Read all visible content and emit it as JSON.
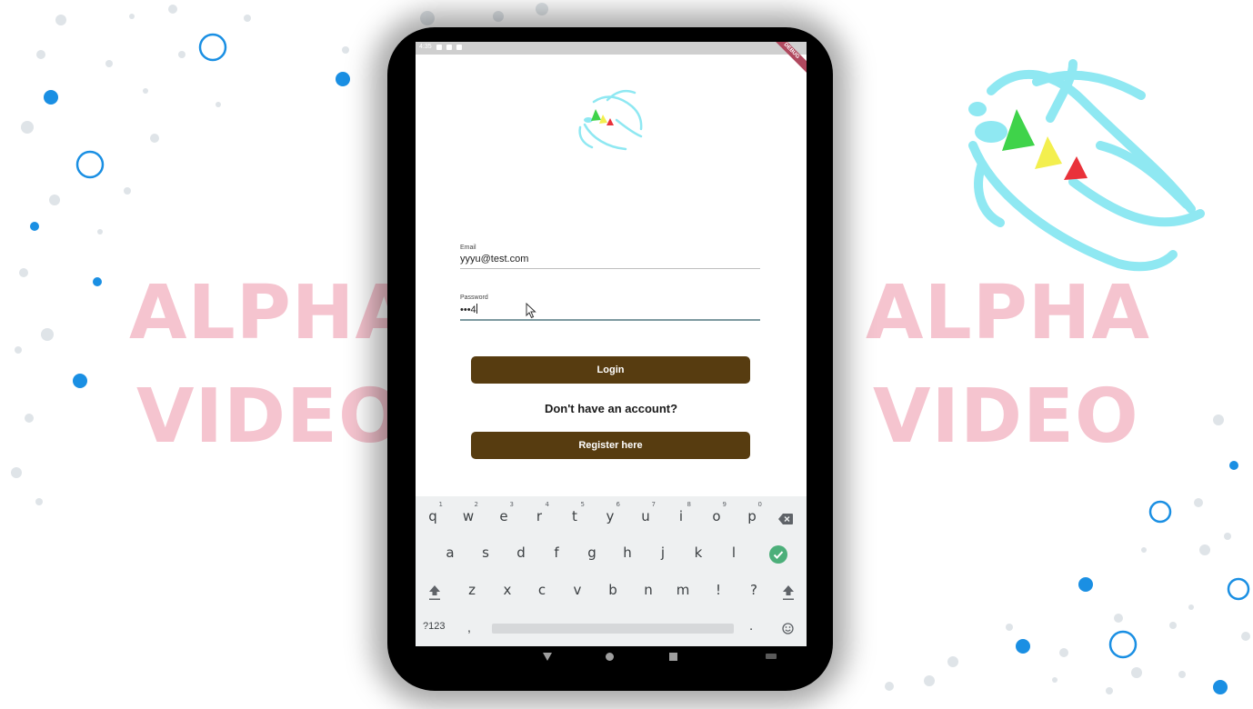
{
  "watermark": {
    "left": [
      "ALPHA",
      "VIDEO"
    ],
    "right": [
      "ALPHA",
      "VIDEO"
    ],
    "color": "#f5c4cf"
  },
  "device": {
    "status_bar": {
      "time": "4:35",
      "debug_badge": "DEBUG"
    }
  },
  "login_form": {
    "email_label": "Email",
    "email_value": "yyyu@test.com",
    "password_label": "Password",
    "password_value": "•••4",
    "login_button": "Login",
    "register_prompt": "Don't have an account?",
    "register_button": "Register here"
  },
  "keyboard": {
    "row1": [
      {
        "k": "q",
        "h": "1"
      },
      {
        "k": "w",
        "h": "2"
      },
      {
        "k": "e",
        "h": "3"
      },
      {
        "k": "r",
        "h": "4"
      },
      {
        "k": "t",
        "h": "5"
      },
      {
        "k": "y",
        "h": "6"
      },
      {
        "k": "u",
        "h": "7"
      },
      {
        "k": "i",
        "h": "8"
      },
      {
        "k": "o",
        "h": "9"
      },
      {
        "k": "p",
        "h": "0"
      }
    ],
    "row2": [
      "a",
      "s",
      "d",
      "f",
      "g",
      "h",
      "j",
      "k",
      "l"
    ],
    "row3": [
      "z",
      "x",
      "c",
      "v",
      "b",
      "n",
      "m",
      "!",
      "?"
    ],
    "symbols_key": "?123",
    "comma_key": ",",
    "period_key": "."
  },
  "colors": {
    "button_brown": "#573c10",
    "bokeh_blue": "#1a8fe3",
    "bug_cyan": "#8fe8f2",
    "bug_green": "#3fd34a",
    "bug_yellow": "#f3ef4e",
    "bug_red": "#e9323a",
    "enter_green": "#4caf7a"
  },
  "icons": [
    "app-bug-logo-icon",
    "backspace-icon",
    "enter-check-icon",
    "shift-icon",
    "emoji-icon",
    "back-nav-icon",
    "home-nav-icon",
    "recents-nav-icon",
    "mouse-cursor-icon"
  ]
}
